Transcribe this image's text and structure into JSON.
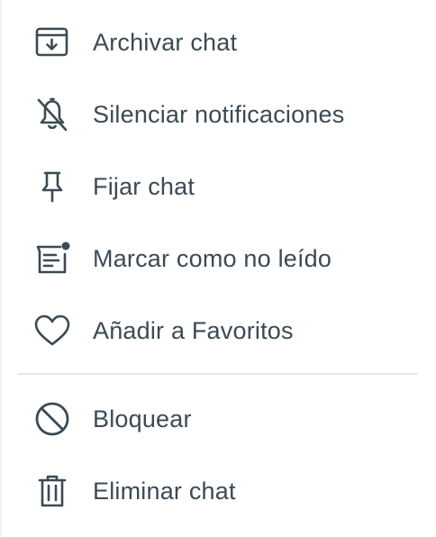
{
  "menu": {
    "items": [
      {
        "id": "archive",
        "label": "Archivar chat",
        "icon": "archive-icon"
      },
      {
        "id": "mute",
        "label": "Silenciar notificaciones",
        "icon": "bell-off-icon"
      },
      {
        "id": "pin",
        "label": "Fijar chat",
        "icon": "pin-icon"
      },
      {
        "id": "unread",
        "label": "Marcar como no leído",
        "icon": "mark-unread-icon"
      },
      {
        "id": "favorite",
        "label": "Añadir a Favoritos",
        "icon": "heart-icon"
      }
    ],
    "secondary_items": [
      {
        "id": "block",
        "label": "Bloquear",
        "icon": "block-icon"
      },
      {
        "id": "delete",
        "label": "Eliminar chat",
        "icon": "trash-icon"
      }
    ]
  },
  "colors": {
    "icon": "#3b4a54",
    "text": "#3b4a54",
    "divider": "#e4e6e8",
    "background": "#ffffff"
  }
}
